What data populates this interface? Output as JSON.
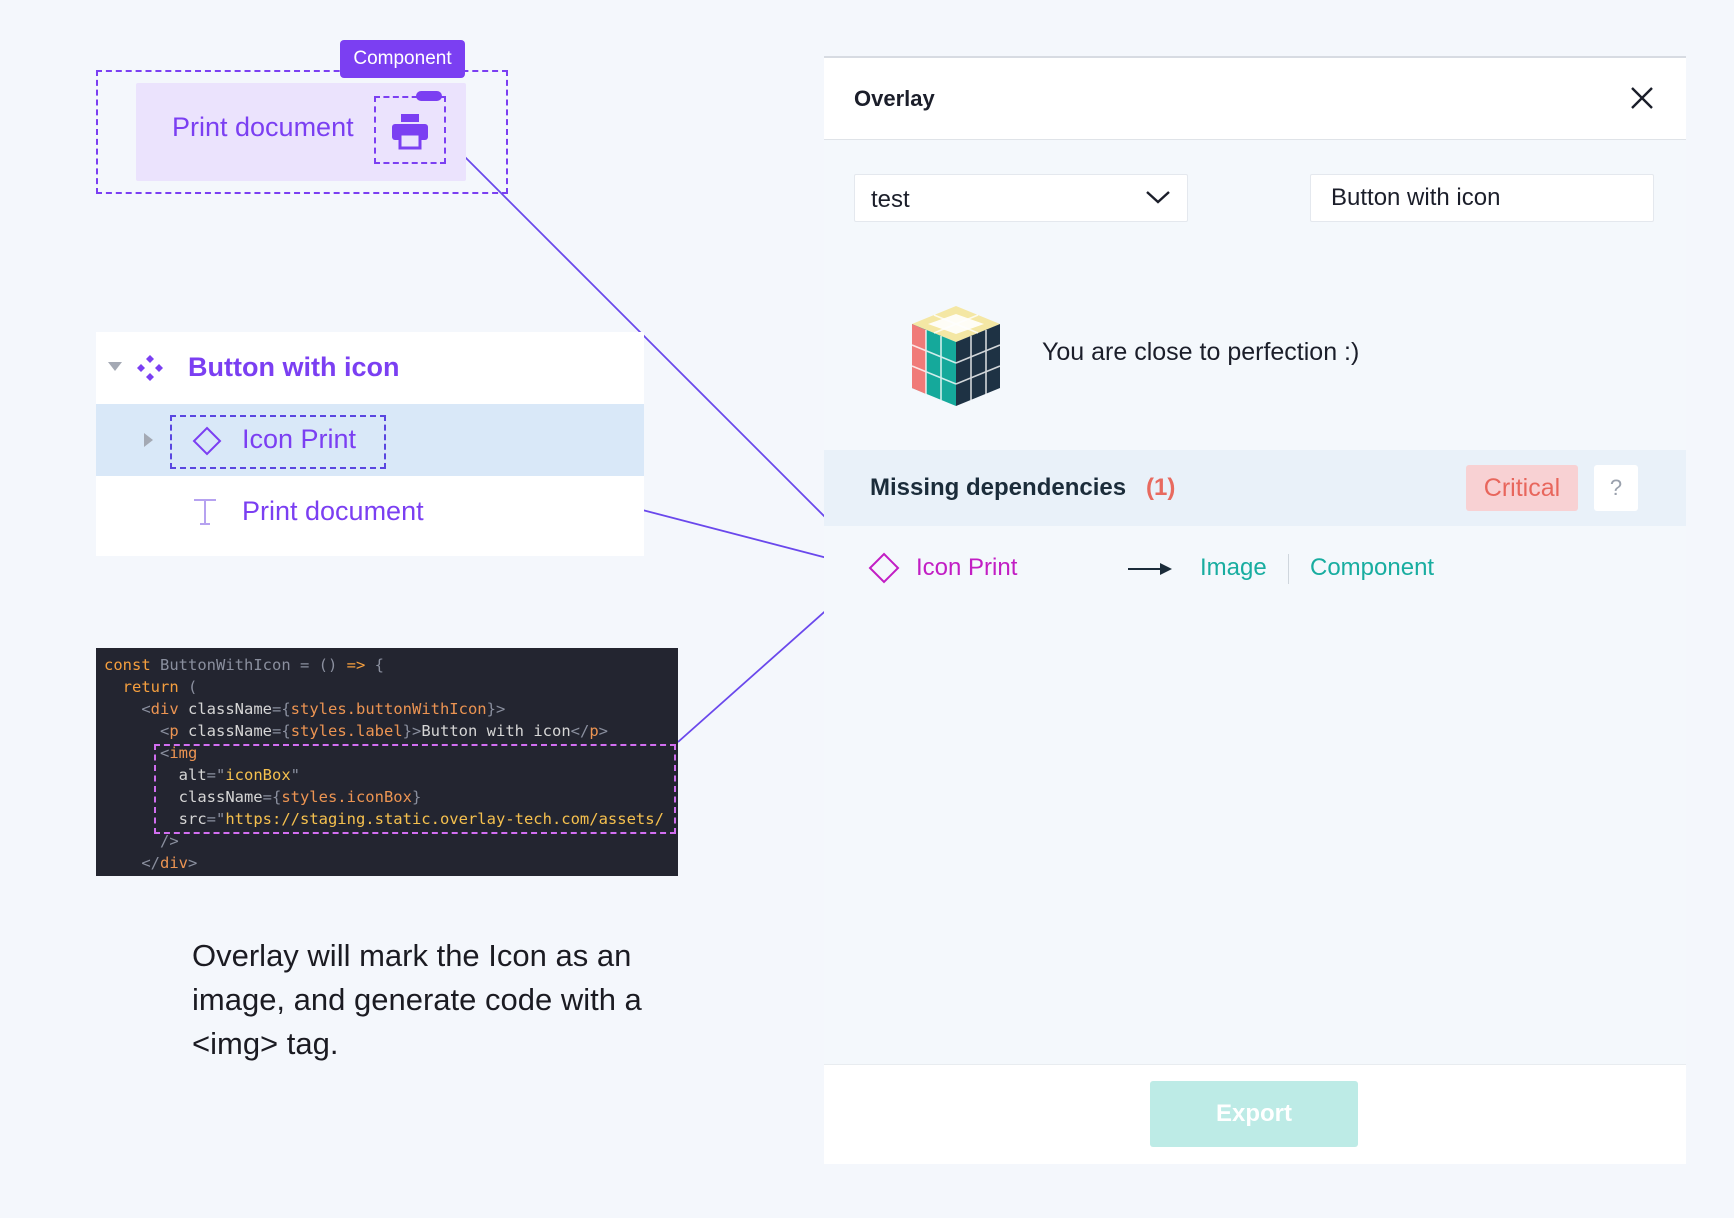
{
  "component_preview": {
    "badge": "Component",
    "button_label": "Print document",
    "icon": "printer-icon"
  },
  "layers": {
    "items": [
      {
        "label": "Button with icon",
        "icon": "component-icon",
        "expanded": true
      },
      {
        "label": "Icon Print",
        "icon": "diamond-instance-icon",
        "selected": true
      },
      {
        "label": "Print document",
        "icon": "text-icon"
      }
    ]
  },
  "code": {
    "lines": [
      "const ButtonWithIcon = () => {",
      "  return (",
      "    <div className={styles.buttonWithIcon}>",
      "      <p className={styles.label}>Button with icon</p>",
      "      <img",
      "        alt=\"iconBox\"",
      "        className={styles.iconBox}",
      "        src=\"https://staging.static.overlay-tech.com/assets/",
      "      />",
      "    </div>"
    ]
  },
  "caption": "Overlay will mark the Icon as an image, and generate code with a <img> tag.",
  "panel": {
    "title": "Overlay",
    "close_icon": "close-icon",
    "select_value": "test",
    "name_input_value": "Button with icon",
    "status_message": "You are close to perfection :)",
    "dependencies": {
      "title": "Missing dependencies",
      "count": "(1)",
      "severity": "Critical",
      "help": "?",
      "items": [
        {
          "name": "Icon Print",
          "option_image": "Image",
          "option_component": "Component"
        }
      ]
    },
    "export_label": "Export"
  },
  "colors": {
    "accent_purple": "#7b3ff2",
    "teal": "#18ada0",
    "critical_bg": "#f8d1d3",
    "critical_text": "#e8665c",
    "magenta": "#c21ec4"
  }
}
